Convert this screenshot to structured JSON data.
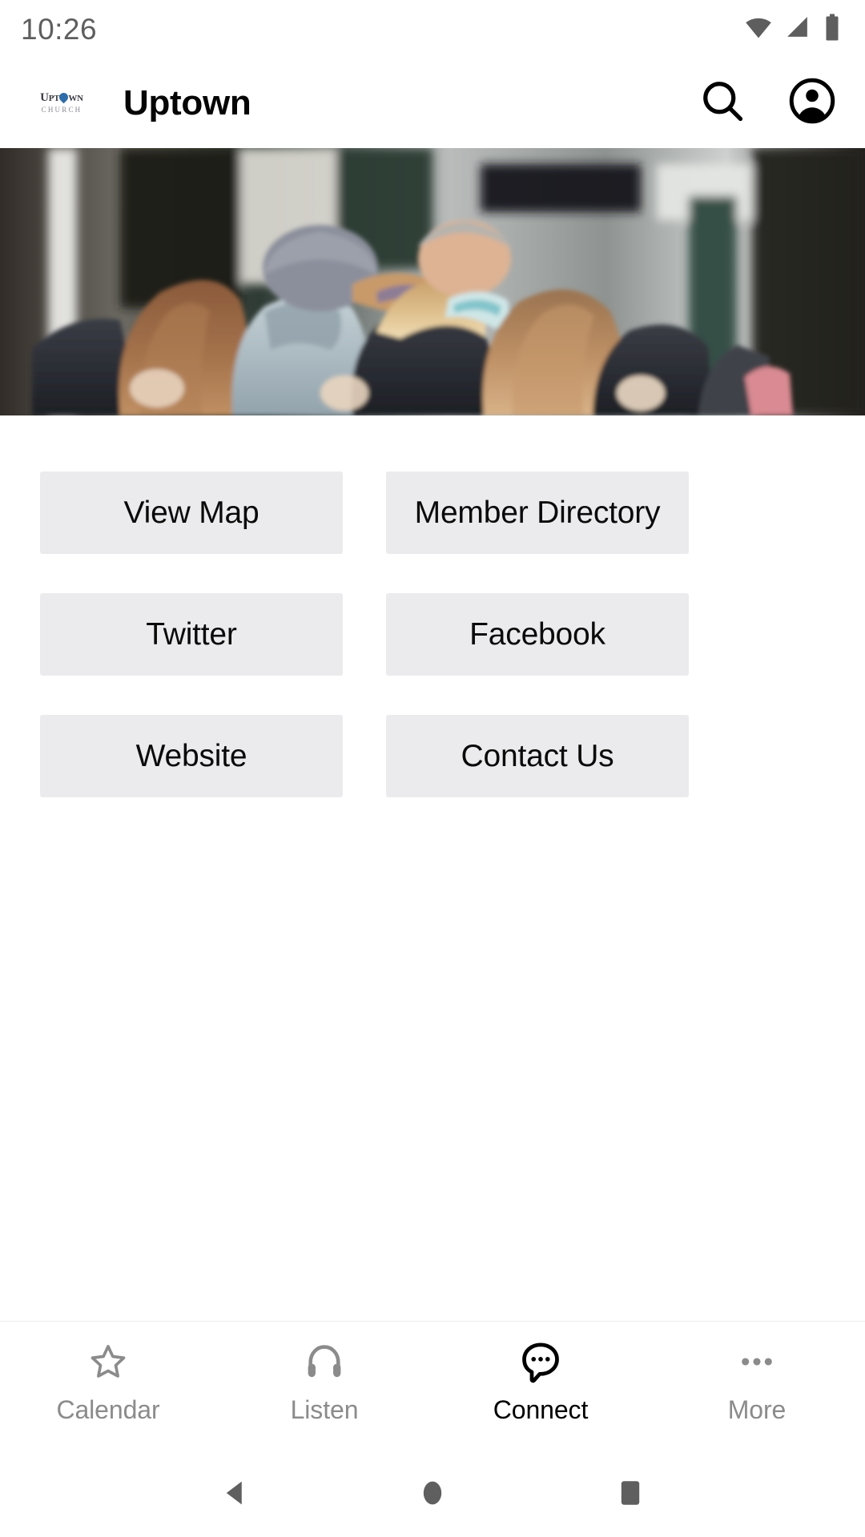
{
  "status_bar": {
    "time": "10:26",
    "icons": [
      "wifi-icon",
      "cellular-signal-icon",
      "battery-icon"
    ]
  },
  "app_bar": {
    "logo": {
      "name": "uptown-church-logo",
      "word_before": "Upt",
      "word_after": "wn",
      "subtitle": "CHURCH",
      "accent_color": "#2f6ca8"
    },
    "title": "Uptown",
    "actions": [
      {
        "name": "search-icon",
        "label": "Search"
      },
      {
        "name": "account-circle-icon",
        "label": "Account"
      }
    ]
  },
  "hero": {
    "name": "hero-photo",
    "alt": "Group of people huddled together outdoors in coats"
  },
  "main": {
    "buttons": [
      {
        "label": "View Map",
        "name": "view-map-button"
      },
      {
        "label": "Member Directory",
        "name": "member-directory-button"
      },
      {
        "label": "Twitter",
        "name": "twitter-button"
      },
      {
        "label": "Facebook",
        "name": "facebook-button"
      },
      {
        "label": "Website",
        "name": "website-button"
      },
      {
        "label": "Contact Us",
        "name": "contact-us-button"
      }
    ],
    "button_fill": "#ebebed"
  },
  "tab_bar": {
    "tabs": [
      {
        "label": "Calendar",
        "icon": "star-outline-icon",
        "active": false
      },
      {
        "label": "Listen",
        "icon": "headphones-icon",
        "active": false
      },
      {
        "label": "Connect",
        "icon": "chat-bubble-dots-icon",
        "active": true
      },
      {
        "label": "More",
        "icon": "ellipsis-icon",
        "active": false
      }
    ],
    "active_color": "#000000",
    "inactive_color": "#8b8b8b"
  },
  "system_nav": {
    "buttons": [
      {
        "name": "back-button",
        "icon": "triangle-left-icon"
      },
      {
        "name": "home-button",
        "icon": "circle-icon"
      },
      {
        "name": "recents-button",
        "icon": "square-icon"
      }
    ]
  }
}
